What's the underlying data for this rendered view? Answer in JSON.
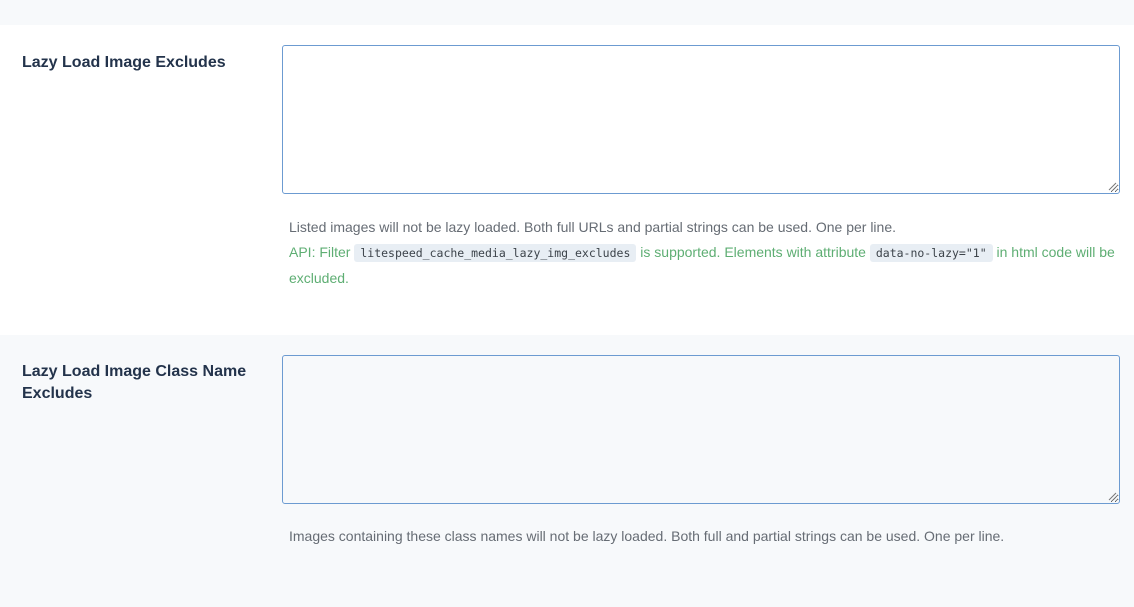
{
  "settings": {
    "lazy_img_excludes": {
      "label": "Lazy Load Image Excludes",
      "value": "",
      "description": "Listed images will not be lazy loaded. Both full URLs and partial strings can be used. One per line.",
      "api_prefix": "API: Filter ",
      "api_filter_code": "litespeed_cache_media_lazy_img_excludes",
      "api_middle": " is supported. Elements with attribute ",
      "api_attr_code": "data-no-lazy=\"1\"",
      "api_suffix": " in html code will be excluded."
    },
    "lazy_img_class_excludes": {
      "label": "Lazy Load Image Class Name Excludes",
      "value": "",
      "description": "Images containing these class names will not be lazy loaded. Both full and partial strings can be used. One per line."
    }
  },
  "colors": {
    "label": "#23334b",
    "description": "#666c74",
    "api_note": "#5eae73",
    "input_border": "#6c9bd1",
    "alt_row_bg": "#f7f9fb"
  }
}
